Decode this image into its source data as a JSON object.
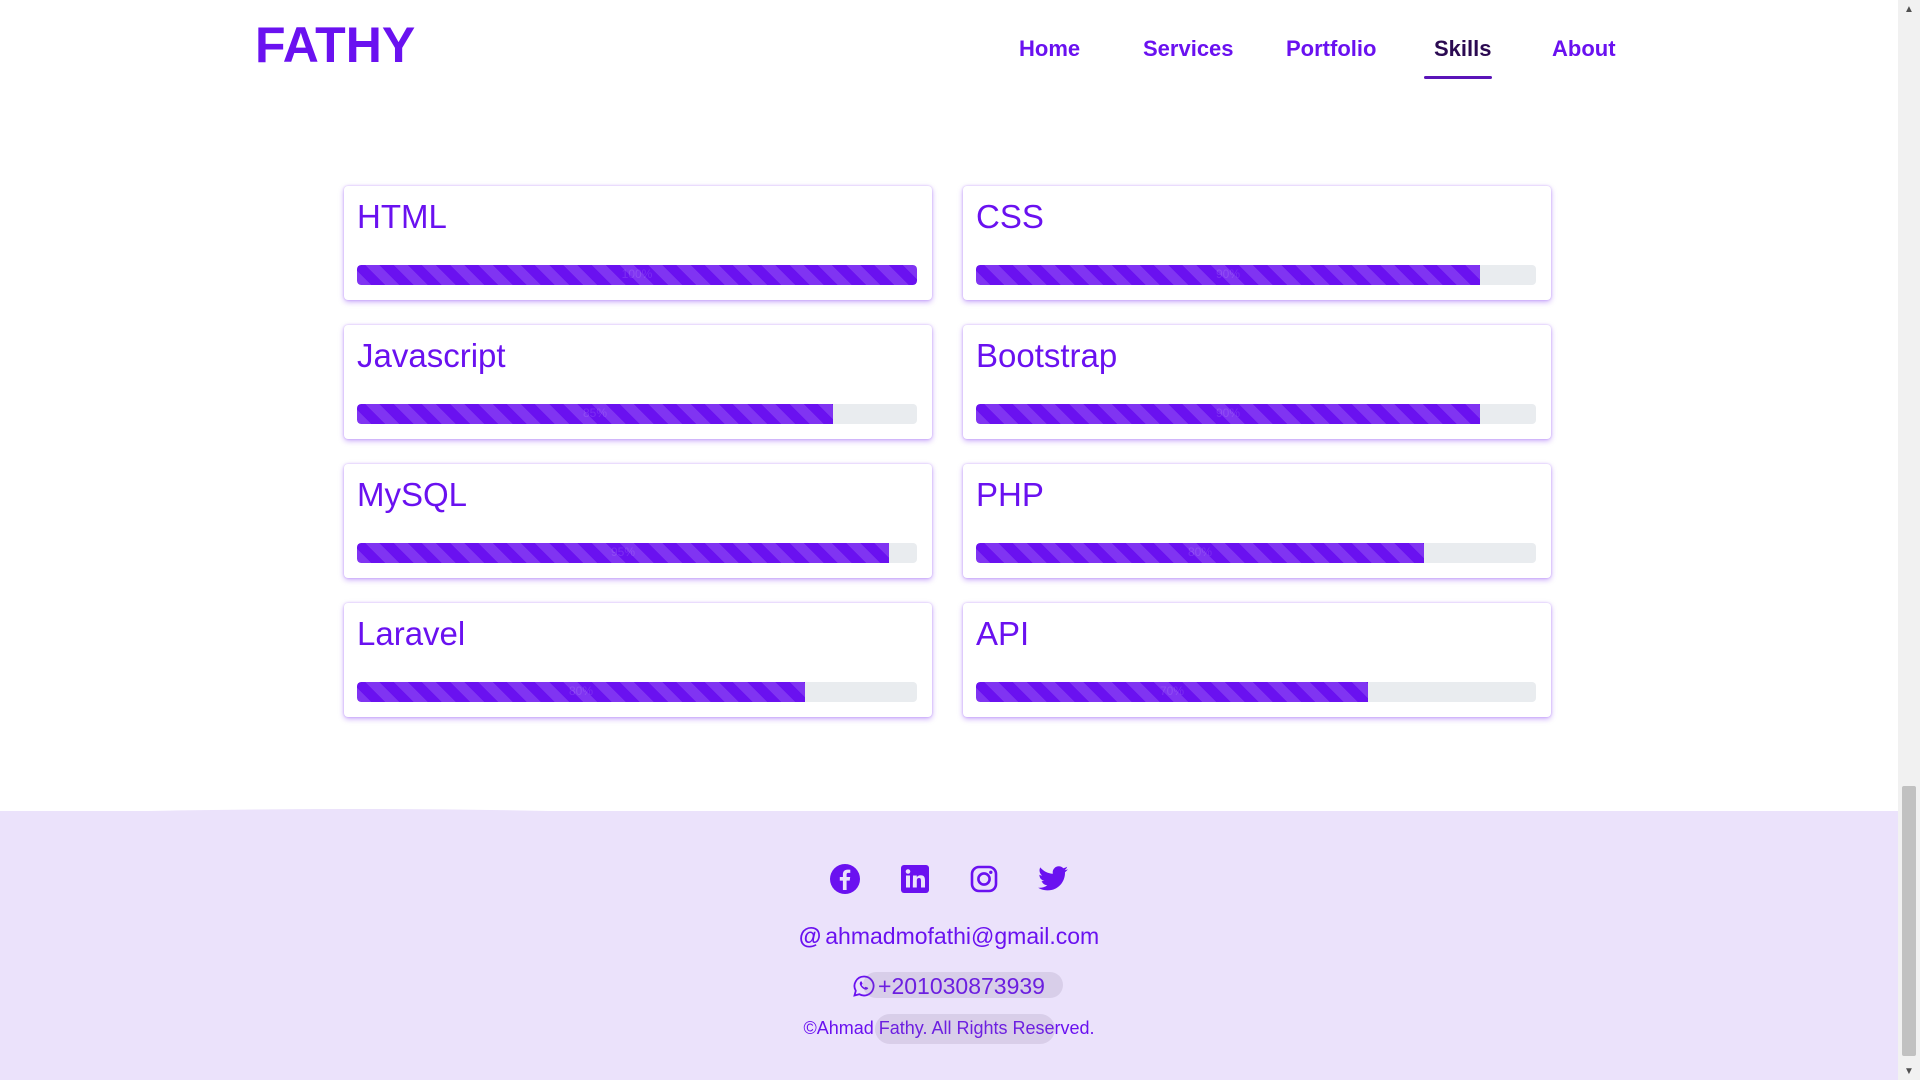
{
  "header": {
    "brand": "FATHY",
    "nav": [
      {
        "label": "Home"
      },
      {
        "label": "Services"
      },
      {
        "label": "Portfolio"
      },
      {
        "label": "Skills",
        "active": true
      },
      {
        "label": "About"
      }
    ]
  },
  "skills": [
    {
      "name": "HTML",
      "level_percent": 100
    },
    {
      "name": "CSS",
      "level_percent": 90
    },
    {
      "name": "Javascript",
      "level_percent": 85
    },
    {
      "name": "Bootstrap",
      "level_percent": 90
    },
    {
      "name": "MySQL",
      "level_percent": 95
    },
    {
      "name": "PHP",
      "level_percent": 80
    },
    {
      "name": "Laravel",
      "level_percent": 80
    },
    {
      "name": "API",
      "level_percent": 70
    }
  ],
  "footer": {
    "social": [
      {
        "icon": "facebook-icon"
      },
      {
        "icon": "linkedin-icon"
      },
      {
        "icon": "instagram-icon"
      },
      {
        "icon": "twitter-icon"
      }
    ],
    "email": "ahmadmofathi@gmail.com",
    "email_glyph": "@",
    "phone": "+201030873939",
    "copyright": "©Ahmad Fathy. All Rights Reserved."
  },
  "colors": {
    "accent": "#6a11f0",
    "nav_active": "#2b0a52",
    "footer_bg": "#ebe2fb",
    "bar_track": "#e9ecef"
  }
}
